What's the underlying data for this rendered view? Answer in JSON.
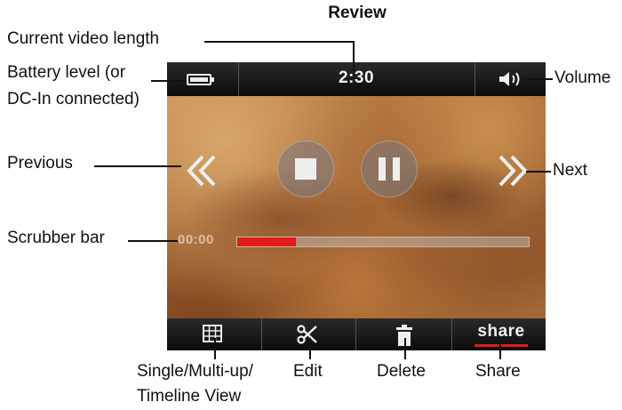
{
  "title": "Review",
  "screen": {
    "video_time": "2:30",
    "scrubber_time": "00:00",
    "scrubber_progress": 0.2,
    "share_label": "share",
    "accent_color": "#e21a1a"
  },
  "callouts": {
    "current_video_length": "Current video length",
    "battery_line1": "Battery level (or",
    "battery_line2": "DC-In connected)",
    "volume": "Volume",
    "previous": "Previous",
    "next": "Next",
    "scrubber_bar": "Scrubber bar",
    "view_line1": "Single/Multi-up/",
    "view_line2": "Timeline View",
    "edit": "Edit",
    "delete": "Delete",
    "share": "Share"
  },
  "icons": {
    "battery": "battery-icon",
    "volume": "speaker-icon",
    "previous": "double-chevron-left-icon",
    "next": "double-chevron-right-icon",
    "stop": "stop-icon",
    "pause": "pause-icon",
    "view": "grid-icon",
    "edit": "scissors-icon",
    "delete": "trash-icon"
  }
}
